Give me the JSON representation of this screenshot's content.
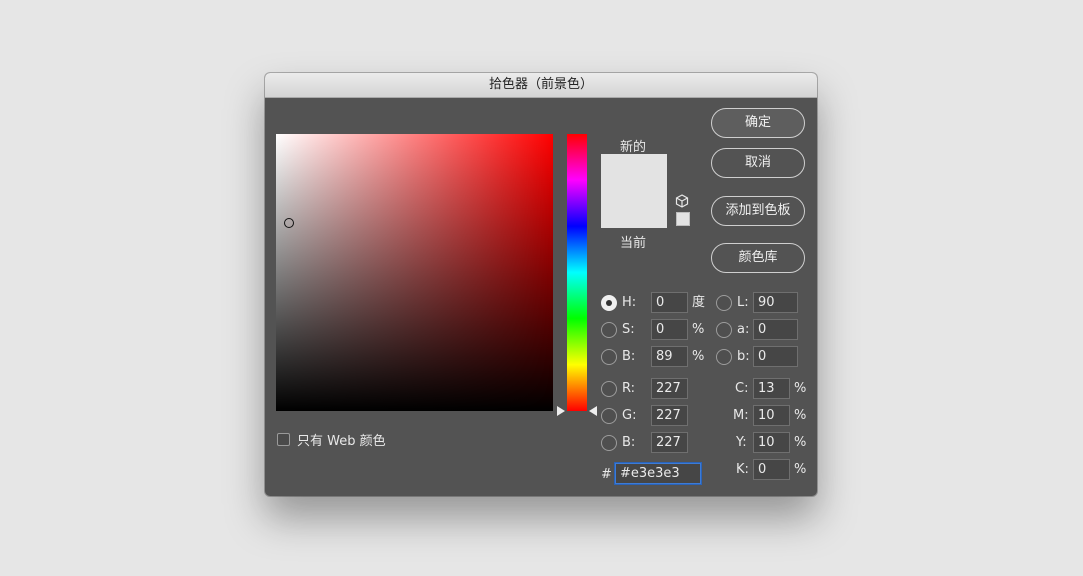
{
  "window": {
    "title": "拾色器（前景色）"
  },
  "picker": {
    "web_only_label": "只有 Web 颜色"
  },
  "preview": {
    "new_label": "新的",
    "current_label": "当前",
    "new_color": "#e3e3e3",
    "current_color": "#e3e3e3"
  },
  "buttons": {
    "ok": "确定",
    "cancel": "取消",
    "add_swatches": "添加到色板",
    "color_libraries": "颜色库"
  },
  "fields": {
    "h": {
      "label": "H:",
      "value": "0",
      "unit": "度"
    },
    "s": {
      "label": "S:",
      "value": "0",
      "unit": "%"
    },
    "b": {
      "label": "B:",
      "value": "89",
      "unit": "%"
    },
    "r": {
      "label": "R:",
      "value": "227"
    },
    "g": {
      "label": "G:",
      "value": "227"
    },
    "bl": {
      "label": "B:",
      "value": "227"
    },
    "l": {
      "label": "L:",
      "value": "90"
    },
    "a": {
      "label": "a:",
      "value": "0"
    },
    "lab_b": {
      "label": "b:",
      "value": "0"
    },
    "c": {
      "label": "C:",
      "value": "13",
      "unit": "%"
    },
    "m": {
      "label": "M:",
      "value": "10",
      "unit": "%"
    },
    "y": {
      "label": "Y:",
      "value": "10",
      "unit": "%"
    },
    "k": {
      "label": "K:",
      "value": "0",
      "unit": "%"
    },
    "hex": {
      "label": "#",
      "value": "#e3e3e3"
    }
  },
  "icons": {
    "gamut": "cube-icon"
  }
}
